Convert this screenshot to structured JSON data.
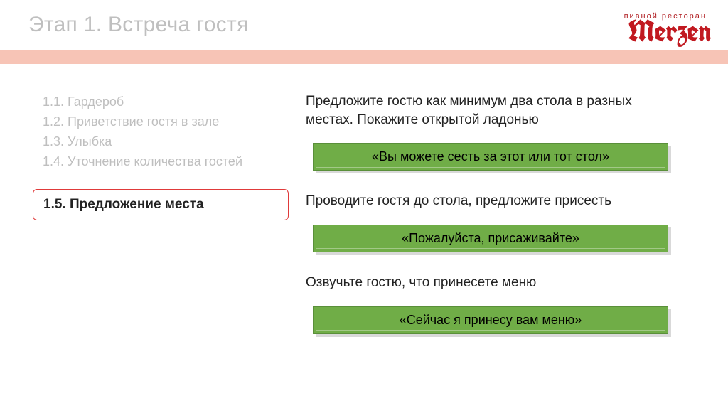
{
  "header": {
    "title": "Этап 1. Встреча гостя",
    "logo_sub": "пивной ресторан",
    "logo_main": "Merzen"
  },
  "toc": {
    "items": [
      "1.1. Гардероб",
      "1.2. Приветствие гостя в зале",
      "1.3. Улыбка",
      "1.4. Уточнение количества гостей"
    ],
    "active": "1.5. Предложение места"
  },
  "blocks": [
    {
      "instruction": "Предложите гостю как минимум два стола в разных местах. Покажите открытой ладонью",
      "phrase": "«Вы можете сесть за этот или тот стол»"
    },
    {
      "instruction": "Проводите гостя до стола, предложите присесть",
      "phrase": "«Пожалуйста, присаживайте»"
    },
    {
      "instruction": "Озвучьте гостю, что принесете меню",
      "phrase": "«Сейчас я принесу вам меню»"
    }
  ]
}
